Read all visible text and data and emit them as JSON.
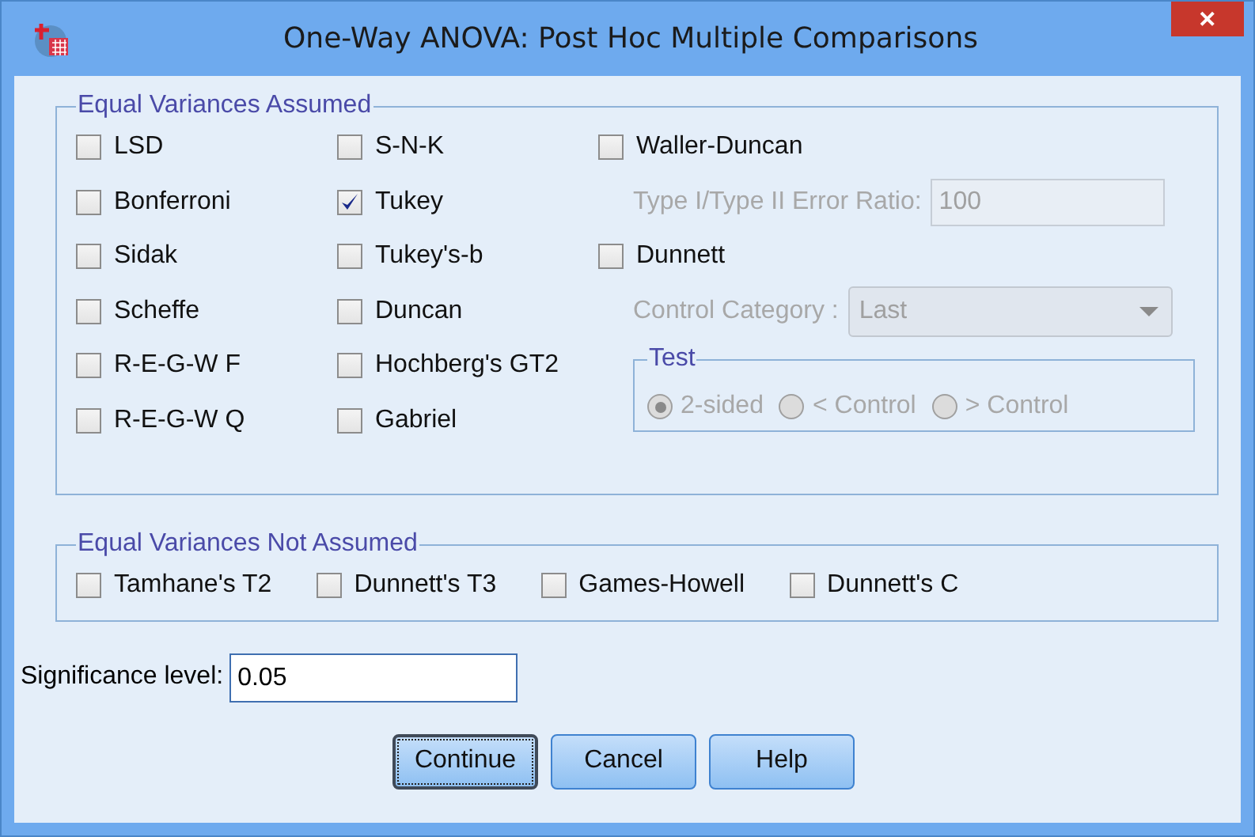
{
  "window": {
    "title": "One-Way ANOVA: Post Hoc Multiple Comparisons",
    "close": "✕"
  },
  "equal_assumed": {
    "title": "Equal Variances Assumed",
    "column_1": [
      {
        "label": "LSD",
        "checked": false
      },
      {
        "label": "Bonferroni",
        "checked": false
      },
      {
        "label": "Sidak",
        "checked": false
      },
      {
        "label": "Scheffe",
        "checked": false
      },
      {
        "label": "R-E-G-W F",
        "checked": false
      },
      {
        "label": "R-E-G-W Q",
        "checked": false
      }
    ],
    "column_2": [
      {
        "label": "S-N-K",
        "checked": false
      },
      {
        "label": "Tukey",
        "checked": true
      },
      {
        "label": "Tukey's-b",
        "checked": false
      },
      {
        "label": "Duncan",
        "checked": false
      },
      {
        "label": "Hochberg's GT2",
        "checked": false
      },
      {
        "label": "Gabriel",
        "checked": false
      }
    ],
    "column_3": [
      {
        "kind": "checkbox",
        "label": "Waller-Duncan",
        "checked": false
      },
      {
        "kind": "field",
        "label": "Type I/Type II Error Ratio:",
        "value": "100",
        "disabled": true
      },
      {
        "kind": "checkbox",
        "label": "Dunnett",
        "checked": false
      },
      {
        "kind": "dropdown",
        "label": "Control Category :",
        "value": "Last",
        "disabled": true
      }
    ],
    "test": {
      "title": "Test",
      "disabled": true,
      "options": [
        {
          "label": "2-sided",
          "selected": true
        },
        {
          "label": "< Control",
          "selected": false
        },
        {
          "label": "> Control",
          "selected": false
        }
      ]
    }
  },
  "equal_not_assumed": {
    "title": "Equal Variances Not Assumed",
    "items": [
      {
        "label": "Tamhane's T2",
        "checked": false
      },
      {
        "label": "Dunnett's T3",
        "checked": false
      },
      {
        "label": "Games-Howell",
        "checked": false
      },
      {
        "label": "Dunnett's C",
        "checked": false
      }
    ]
  },
  "significance": {
    "label": "Significance level:",
    "value": "0.05"
  },
  "buttons": [
    {
      "label": "Continue",
      "focused": true
    },
    {
      "label": "Cancel",
      "focused": false
    },
    {
      "label": "Help",
      "focused": false
    }
  ]
}
